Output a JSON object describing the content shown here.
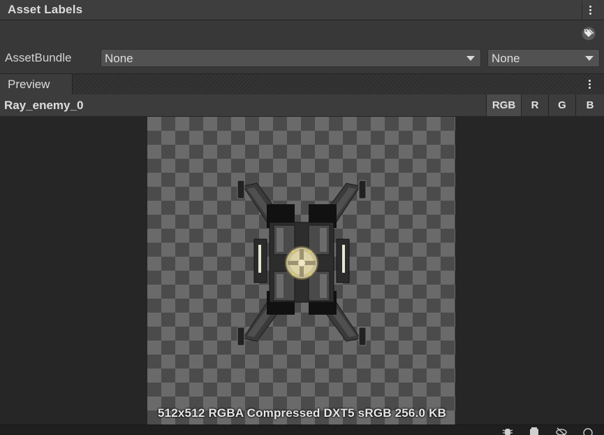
{
  "asset_labels": {
    "title": "Asset Labels",
    "menu_icon": "kebab-menu-icon",
    "tag_icon": "tag-icon"
  },
  "asset_bundle": {
    "label": "AssetBundle",
    "name_value": "None",
    "variant_value": "None"
  },
  "preview": {
    "tab_label": "Preview",
    "asset_name": "Ray_enemy_0",
    "channels": [
      "RGB",
      "R",
      "G",
      "B"
    ],
    "active_channel": "RGB",
    "info": "512x512  RGBA Compressed DXT5 sRGB   256.0 KB"
  },
  "status_bar": {
    "icons": [
      "bug-icon",
      "layers-icon",
      "eye-slash-icon",
      "circle-icon"
    ]
  },
  "colors": {
    "panel_bg": "#383838",
    "header_bg": "#3e3e3e",
    "preview_bg": "#262626",
    "dropdown_bg": "#515151",
    "text": "#d2d2d2"
  }
}
